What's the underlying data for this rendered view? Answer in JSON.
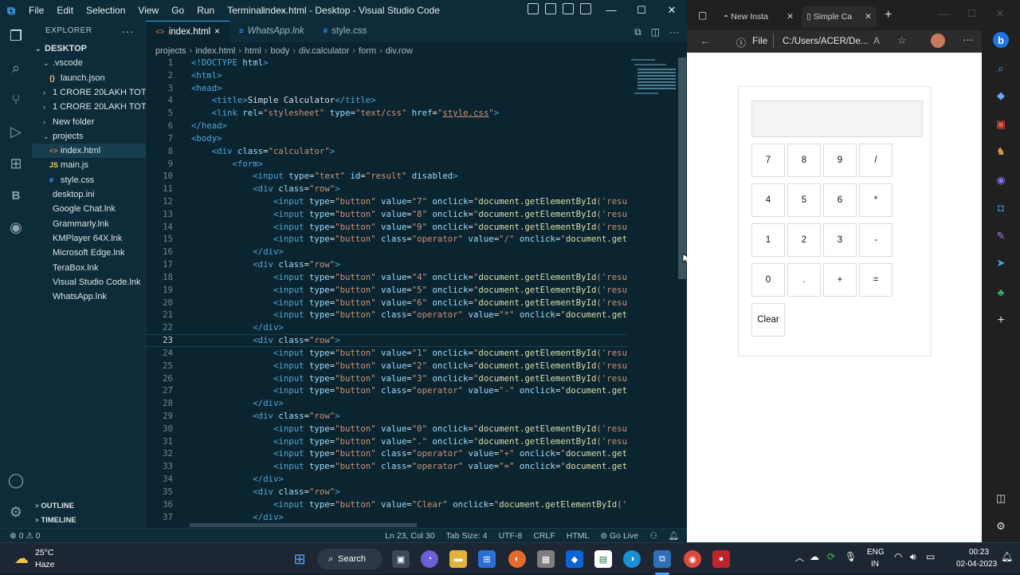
{
  "vscode": {
    "menu": [
      "File",
      "Edit",
      "Selection",
      "View",
      "Go",
      "Run",
      "Terminal",
      "···"
    ],
    "window_title": "index.html - Desktop - Visual Studio Code",
    "explorer_label": "EXPLORER",
    "tree": [
      {
        "label": "DESKTOP",
        "chev": "v"
      },
      {
        "label": ".vscode",
        "chev": "v"
      },
      {
        "label": "launch.json",
        "icon": "{}"
      },
      {
        "label": "1 CRORE 20LAKH TOT...",
        "chev": ">"
      },
      {
        "label": "1 CRORE 20LAKH TOT...",
        "chev": ">"
      },
      {
        "label": "New folder",
        "chev": ">"
      },
      {
        "label": "projects",
        "chev": "v"
      },
      {
        "label": "index.html",
        "icon": "<>"
      },
      {
        "label": "main.js",
        "icon": "JS"
      },
      {
        "label": "style.css",
        "icon": "#"
      },
      {
        "label": "desktop.ini"
      },
      {
        "label": "Google Chat.lnk"
      },
      {
        "label": "Grammarly.lnk"
      },
      {
        "label": "KMPlayer 64X.lnk"
      },
      {
        "label": "Microsoft Edge.lnk"
      },
      {
        "label": "TeraBox.lnk"
      },
      {
        "label": "Visual Studio Code.lnk"
      },
      {
        "label": "WhatsApp.lnk"
      }
    ],
    "outline": "OUTLINE",
    "timeline": "TIMELINE",
    "tabs": [
      {
        "label": "index.html",
        "icon": "<>",
        "close": "×"
      },
      {
        "label": "WhatsApp.lnk",
        "icon": "≡"
      },
      {
        "label": "style.css",
        "icon": "#"
      }
    ],
    "breadcrumb": [
      "projects",
      "index.html",
      "html",
      "body",
      "div.calculator",
      "form",
      "div.row"
    ],
    "code_lines": [
      {
        "n": "1",
        "html": "<span class='t-tag'>&lt;!DOCTYPE</span> <span class='t-attr'>html</span><span class='t-tag'>&gt;</span>"
      },
      {
        "n": "2",
        "html": "<span class='t-tag'>&lt;html&gt;</span>"
      },
      {
        "n": "3",
        "html": "<span class='t-tag'>&lt;head&gt;</span>"
      },
      {
        "n": "4",
        "html": "    <span class='t-tag'>&lt;title&gt;</span>Simple Calculator<span class='t-tag'>&lt;/title&gt;</span>"
      },
      {
        "n": "5",
        "html": "    <span class='t-tag'>&lt;link</span> <span class='t-attr'>rel</span>=<span class='t-str'>\"stylesheet\"</span> <span class='t-attr'>type</span>=<span class='t-str'>\"text/css\"</span> <span class='t-attr'>href</span>=<span class='t-str'>\"</span><span class='t-lnk'>style.css</span><span class='t-str'>\"</span><span class='t-tag'>&gt;</span>"
      },
      {
        "n": "6",
        "html": "<span class='t-tag'>&lt;/head&gt;</span>"
      },
      {
        "n": "7",
        "html": "<span class='t-tag'>&lt;body&gt;</span>"
      },
      {
        "n": "8",
        "html": "    <span class='t-tag'>&lt;div</span> <span class='t-attr'>class</span>=<span class='t-str'>\"calculator\"</span><span class='t-tag'>&gt;</span>"
      },
      {
        "n": "9",
        "html": "        <span class='t-tag'>&lt;form&gt;</span>"
      },
      {
        "n": "10",
        "html": "            <span class='t-tag'>&lt;input</span> <span class='t-attr'>type</span>=<span class='t-str'>\"text\"</span> <span class='t-attr'>id</span>=<span class='t-str'>\"result\"</span> <span class='t-attr'>disabled</span><span class='t-tag'>&gt;</span>"
      },
      {
        "n": "11",
        "html": "            <span class='t-tag'>&lt;div</span> <span class='t-attr'>class</span>=<span class='t-str'>\"row\"</span><span class='t-tag'>&gt;</span>"
      },
      {
        "n": "12",
        "html": "                <span class='t-tag'>&lt;input</span> <span class='t-attr'>type</span>=<span class='t-str'>\"button\"</span> <span class='t-attr'>value</span>=<span class='t-str'>\"7\"</span> <span class='t-attr'>onclick</span>=<span class='t-str'>\"</span><span class='t-fn'>document.getElementById</span><span class='t-str'>('resu</span>"
      },
      {
        "n": "13",
        "html": "                <span class='t-tag'>&lt;input</span> <span class='t-attr'>type</span>=<span class='t-str'>\"button\"</span> <span class='t-attr'>value</span>=<span class='t-str'>\"8\"</span> <span class='t-attr'>onclick</span>=<span class='t-str'>\"</span><span class='t-fn'>document.getElementById</span><span class='t-str'>('resu</span>"
      },
      {
        "n": "14",
        "html": "                <span class='t-tag'>&lt;input</span> <span class='t-attr'>type</span>=<span class='t-str'>\"button\"</span> <span class='t-attr'>value</span>=<span class='t-str'>\"9\"</span> <span class='t-attr'>onclick</span>=<span class='t-str'>\"</span><span class='t-fn'>document.getElementById</span><span class='t-str'>('resu</span>"
      },
      {
        "n": "15",
        "html": "                <span class='t-tag'>&lt;input</span> <span class='t-attr'>type</span>=<span class='t-str'>\"button\"</span> <span class='t-attr'>class</span>=<span class='t-str'>\"operator\"</span> <span class='t-attr'>value</span>=<span class='t-str'>\"/\"</span> <span class='t-attr'>onclick</span>=<span class='t-str'>\"</span><span class='t-fn'>document.getE</span>"
      },
      {
        "n": "16",
        "html": "            <span class='t-tag'>&lt;/div&gt;</span>"
      },
      {
        "n": "17",
        "html": "            <span class='t-tag'>&lt;div</span> <span class='t-attr'>class</span>=<span class='t-str'>\"row\"</span><span class='t-tag'>&gt;</span>"
      },
      {
        "n": "18",
        "html": "                <span class='t-tag'>&lt;input</span> <span class='t-attr'>type</span>=<span class='t-str'>\"button\"</span> <span class='t-attr'>value</span>=<span class='t-str'>\"4\"</span> <span class='t-attr'>onclick</span>=<span class='t-str'>\"</span><span class='t-fn'>document.getElementById</span><span class='t-str'>('resu</span>"
      },
      {
        "n": "19",
        "html": "                <span class='t-tag'>&lt;input</span> <span class='t-attr'>type</span>=<span class='t-str'>\"button\"</span> <span class='t-attr'>value</span>=<span class='t-str'>\"5\"</span> <span class='t-attr'>onclick</span>=<span class='t-str'>\"</span><span class='t-fn'>document.getElementById</span><span class='t-str'>('resu</span>"
      },
      {
        "n": "20",
        "html": "                <span class='t-tag'>&lt;input</span> <span class='t-attr'>type</span>=<span class='t-str'>\"button\"</span> <span class='t-attr'>value</span>=<span class='t-str'>\"6\"</span> <span class='t-attr'>onclick</span>=<span class='t-str'>\"</span><span class='t-fn'>document.getElementById</span><span class='t-str'>('resu</span>"
      },
      {
        "n": "21",
        "html": "                <span class='t-tag'>&lt;input</span> <span class='t-attr'>type</span>=<span class='t-str'>\"button\"</span> <span class='t-attr'>class</span>=<span class='t-str'>\"operator\"</span> <span class='t-attr'>value</span>=<span class='t-str'>\"*\"</span> <span class='t-attr'>onclick</span>=<span class='t-str'>\"</span><span class='t-fn'>document.getE</span>"
      },
      {
        "n": "22",
        "html": "            <span class='t-tag'>&lt;/div&gt;</span>"
      },
      {
        "n": "23",
        "html": "            <span class='t-tag'>&lt;div</span> <span class='t-attr'>class</span>=<span class='t-str'>\"row\"</span><span class='t-tag'>&gt;</span>"
      },
      {
        "n": "24",
        "html": "                <span class='t-tag'>&lt;input</span> <span class='t-attr'>type</span>=<span class='t-str'>\"button\"</span> <span class='t-attr'>value</span>=<span class='t-str'>\"1\"</span> <span class='t-attr'>onclick</span>=<span class='t-str'>\"</span><span class='t-fn'>document.getElementById</span><span class='t-str'>('resu</span>"
      },
      {
        "n": "25",
        "html": "                <span class='t-tag'>&lt;input</span> <span class='t-attr'>type</span>=<span class='t-str'>\"button\"</span> <span class='t-attr'>value</span>=<span class='t-str'>\"2\"</span> <span class='t-attr'>onclick</span>=<span class='t-str'>\"</span><span class='t-fn'>document.getElementById</span><span class='t-str'>('resu</span>"
      },
      {
        "n": "26",
        "html": "                <span class='t-tag'>&lt;input</span> <span class='t-attr'>type</span>=<span class='t-str'>\"button\"</span> <span class='t-attr'>value</span>=<span class='t-str'>\"3\"</span> <span class='t-attr'>onclick</span>=<span class='t-str'>\"</span><span class='t-fn'>document.getElementById</span><span class='t-str'>('resu</span>"
      },
      {
        "n": "27",
        "html": "                <span class='t-tag'>&lt;input</span> <span class='t-attr'>type</span>=<span class='t-str'>\"button\"</span> <span class='t-attr'>class</span>=<span class='t-str'>\"operator\"</span> <span class='t-attr'>value</span>=<span class='t-str'>\"-\"</span> <span class='t-attr'>onclick</span>=<span class='t-str'>\"</span><span class='t-fn'>document.getE</span>"
      },
      {
        "n": "28",
        "html": "            <span class='t-tag'>&lt;/div&gt;</span>"
      },
      {
        "n": "29",
        "html": "            <span class='t-tag'>&lt;div</span> <span class='t-attr'>class</span>=<span class='t-str'>\"row\"</span><span class='t-tag'>&gt;</span>"
      },
      {
        "n": "30",
        "html": "                <span class='t-tag'>&lt;input</span> <span class='t-attr'>type</span>=<span class='t-str'>\"button\"</span> <span class='t-attr'>value</span>=<span class='t-str'>\"0\"</span> <span class='t-attr'>onclick</span>=<span class='t-str'>\"</span><span class='t-fn'>document.getElementById</span><span class='t-str'>('resu</span>"
      },
      {
        "n": "31",
        "html": "                <span class='t-tag'>&lt;input</span> <span class='t-attr'>type</span>=<span class='t-str'>\"button\"</span> <span class='t-attr'>value</span>=<span class='t-str'>\".\"</span> <span class='t-attr'>onclick</span>=<span class='t-str'>\"</span><span class='t-fn'>document.getElementById</span><span class='t-str'>('resu</span>"
      },
      {
        "n": "32",
        "html": "                <span class='t-tag'>&lt;input</span> <span class='t-attr'>type</span>=<span class='t-str'>\"button\"</span> <span class='t-attr'>class</span>=<span class='t-str'>\"operator\"</span> <span class='t-attr'>value</span>=<span class='t-str'>\"+\"</span> <span class='t-attr'>onclick</span>=<span class='t-str'>\"</span><span class='t-fn'>document.getE</span>"
      },
      {
        "n": "33",
        "html": "                <span class='t-tag'>&lt;input</span> <span class='t-attr'>type</span>=<span class='t-str'>\"button\"</span> <span class='t-attr'>class</span>=<span class='t-str'>\"operator\"</span> <span class='t-attr'>value</span>=<span class='t-str'>\"=\"</span> <span class='t-attr'>onclick</span>=<span class='t-str'>\"</span><span class='t-fn'>document.getE</span>"
      },
      {
        "n": "34",
        "html": "            <span class='t-tag'>&lt;/div&gt;</span>"
      },
      {
        "n": "35",
        "html": "            <span class='t-tag'>&lt;div</span> <span class='t-attr'>class</span>=<span class='t-str'>\"row\"</span><span class='t-tag'>&gt;</span>"
      },
      {
        "n": "36",
        "html": "                <span class='t-tag'>&lt;input</span> <span class='t-attr'>type</span>=<span class='t-str'>\"button\"</span> <span class='t-attr'>value</span>=<span class='t-str'>\"Clear\"</span> <span class='t-attr'>onclick</span>=<span class='t-str'>\"</span><span class='t-fn'>document.getElementById</span><span class='t-str'>('r</span>"
      },
      {
        "n": "37",
        "html": "            <span class='t-tag'>&lt;/div&gt;</span>"
      }
    ],
    "current_line": "23",
    "status": {
      "problems": "⊗ 0 ⚠ 0",
      "position": "Ln 23, Col 30",
      "tab_size": "Tab Size: 4",
      "encoding": "UTF-8",
      "eol": "CRLF",
      "language": "HTML",
      "go_live": "⊚ Go Live"
    }
  },
  "edge": {
    "tabs": [
      {
        "label": "New Insta"
      },
      {
        "label": "Simple Ca"
      }
    ],
    "url_prefix": "File",
    "url": "C:/Users/ACER/De...",
    "calculator": {
      "rows": [
        [
          "7",
          "8",
          "9",
          "/"
        ],
        [
          "4",
          "5",
          "6",
          "*"
        ],
        [
          "1",
          "2",
          "3",
          "-"
        ],
        [
          "0",
          ".",
          "+",
          "="
        ]
      ],
      "clear": "Clear"
    }
  },
  "taskbar": {
    "weather_temp": "25°C",
    "weather_desc": "Haze",
    "search_label": "Search",
    "lang_top": "ENG",
    "lang_bottom": "IN",
    "time": "00:23",
    "date": "02-04-2023"
  }
}
